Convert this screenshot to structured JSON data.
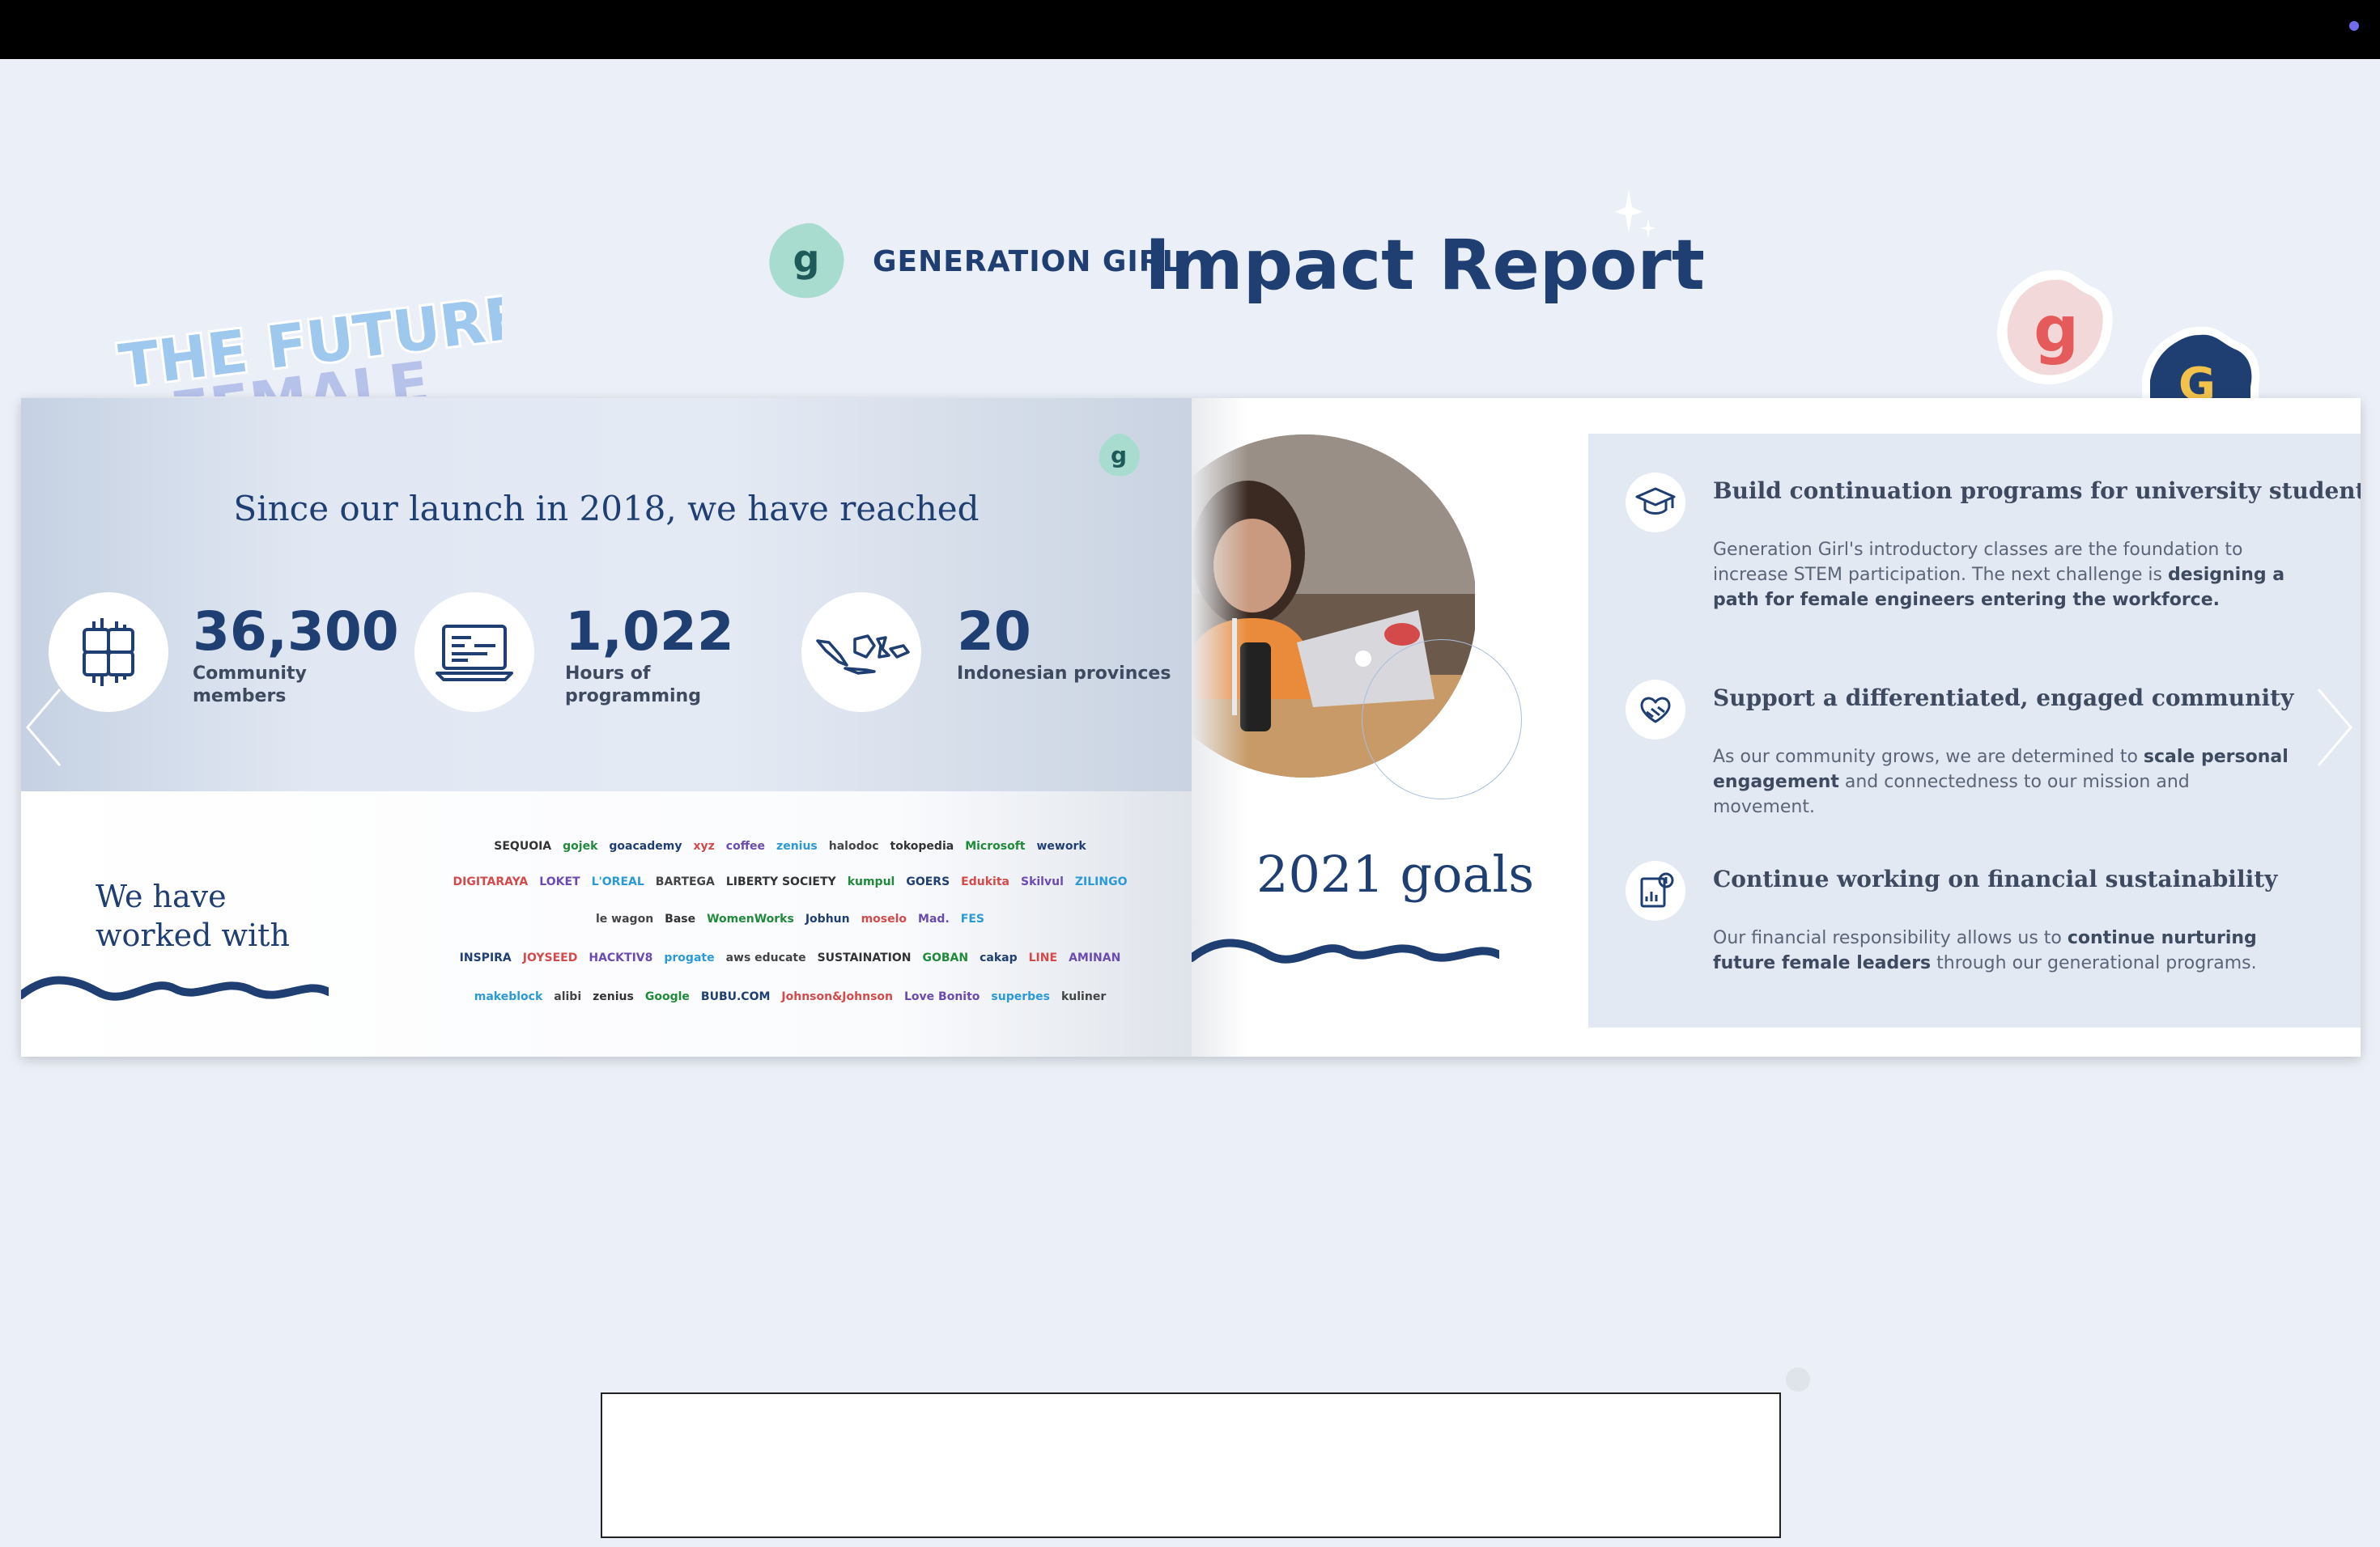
{
  "header": {
    "brand": "GENERATION GIRL",
    "title": "Impact Report",
    "sticker_text_1": "THE FUTURE",
    "sticker_text_2": "FEMALE"
  },
  "left_page": {
    "headline": "Since our launch in 2018, we have reached",
    "stats": [
      {
        "number": "36,300",
        "label_1": "Community",
        "label_2": "members",
        "icon": "hands-together-icon"
      },
      {
        "number": "1,022",
        "label_1": "Hours of",
        "label_2": "programming",
        "icon": "laptop-code-icon"
      },
      {
        "number": "20",
        "label_1": "Indonesian provinces",
        "label_2": "",
        "icon": "indonesia-map-icon"
      }
    ],
    "worked_with": "We have worked with",
    "partner_rows": [
      [
        "SEQUOIA",
        "gojek",
        "goacademy",
        "xyz",
        "coffee",
        "zenius",
        "halodoc",
        "tokopedia",
        "Microsoft",
        "wework"
      ],
      [
        "DIGITARAYA",
        "LOKET",
        "L'OREAL",
        "BARTEGA",
        "LIBERTY SOCIETY",
        "kumpul",
        "GOERS",
        "Edukita",
        "Skilvul",
        "ZILINGO"
      ],
      [
        "le wagon",
        "Base",
        "WomenWorks",
        "Jobhun",
        "moselo",
        "Mad.",
        "FES"
      ],
      [
        "INSPIRA",
        "JOYSEED",
        "HACKTIV8",
        "progate",
        "aws educate",
        "SUSTAINATION",
        "GOBAN",
        "cakap",
        "LINE",
        "AMINAN"
      ],
      [
        "makeblock",
        "alibi",
        "zenius",
        "Google",
        "BUBU.COM",
        "Johnson&Johnson",
        "Love Bonito",
        "superbes",
        "kuliner"
      ]
    ]
  },
  "right_page": {
    "goals_title": "2021 goals",
    "goals": [
      {
        "icon": "graduation-cap-icon",
        "title": "Build continuation programs for university students",
        "body_1": "Generation Girl's introductory classes are the foundation to increase STEM participation. The next challenge is ",
        "body_bold": "designing a path for female engineers entering the workforce.",
        "body_2": ""
      },
      {
        "icon": "handshake-heart-icon",
        "title": "Support a differentiated, engaged community",
        "body_1": "As our community grows, we are determined to ",
        "body_bold": "scale personal engagement",
        "body_2": " and connectedness to our mission and movement."
      },
      {
        "icon": "financial-chart-icon",
        "title": "Continue working on financial sustainability",
        "body_1": "Our financial responsibility allows us to ",
        "body_bold": "continue nurturing future female leaders",
        "body_2": " through our generational programs."
      }
    ]
  },
  "colors": {
    "navy": "#1f3f73",
    "teal": "#a8dccf",
    "pink": "#e55a5a",
    "panel": "#e2e9f3"
  }
}
